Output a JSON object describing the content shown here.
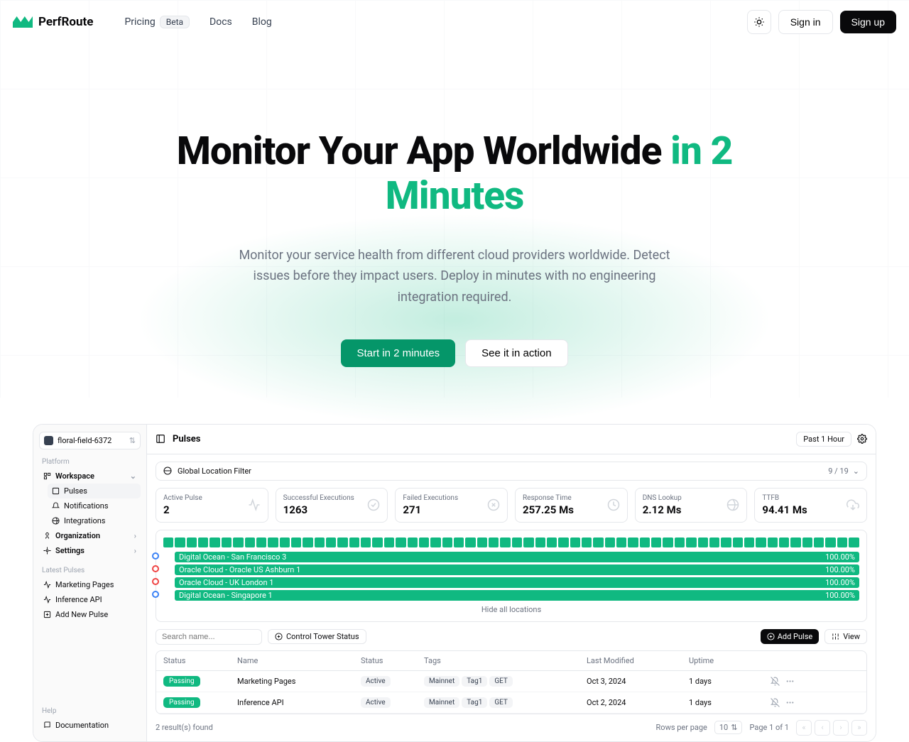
{
  "brand": "PerfRoute",
  "nav": {
    "pricing": "Pricing",
    "pricing_badge": "Beta",
    "docs": "Docs",
    "blog": "Blog"
  },
  "header": {
    "signin": "Sign in",
    "signup": "Sign up"
  },
  "hero": {
    "title_pre": "Monitor Your App Worldwide ",
    "title_accent": "in 2 Minutes",
    "subtitle": "Monitor your service health from different cloud providers worldwide. Detect issues before they impact users. Deploy in minutes with no engineering integration required.",
    "cta_primary": "Start in 2 minutes",
    "cta_secondary": "See it in action"
  },
  "dashboard": {
    "workspace_name": "floral-field-6372",
    "sidebar": {
      "platform_label": "Platform",
      "workspace": "Workspace",
      "pulses": "Pulses",
      "notifications": "Notifications",
      "integrations": "Integrations",
      "organization": "Organization",
      "settings": "Settings",
      "latest_label": "Latest Pulses",
      "lp1": "Marketing Pages",
      "lp2": "Inference API",
      "add_new": "Add New Pulse",
      "help_label": "Help",
      "documentation": "Documentation"
    },
    "topbar": {
      "title": "Pulses",
      "range": "Past 1 Hour"
    },
    "filter": {
      "label": "Global Location Filter",
      "count": "9 / 19"
    },
    "stats": {
      "s1_label": "Active Pulse",
      "s1_value": "2",
      "s2_label": "Successful Executions",
      "s2_value": "1263",
      "s3_label": "Failed Executions",
      "s3_value": "271",
      "s4_label": "Response Time",
      "s4_value": "257.25 Ms",
      "s5_label": "DNS Lookup",
      "s5_value": "2.12 Ms",
      "s6_label": "TTFB",
      "s6_value": "94.41 Ms"
    },
    "locations": {
      "l1_name": "Digital Ocean - San Francisco 3",
      "l1_pct": "100.00%",
      "l2_name": "Oracle Cloud - Oracle US Ashburn 1",
      "l2_pct": "100.00%",
      "l3_name": "Oracle Cloud - UK London 1",
      "l3_pct": "100.00%",
      "l4_name": "Digital Ocean - Singapore 1",
      "l4_pct": "100.00%",
      "hide_all": "Hide all locations"
    },
    "table": {
      "search_placeholder": "Search name...",
      "control_tower": "Control Tower Status",
      "add_pulse": "Add Pulse",
      "view": "View",
      "h_status": "Status",
      "h_name": "Name",
      "h_status2": "Status",
      "h_tags": "Tags",
      "h_modified": "Last Modified",
      "h_uptime": "Uptime",
      "r1_status": "Passing",
      "r1_name": "Marketing Pages",
      "r1_state": "Active",
      "r1_t1": "Mainnet",
      "r1_t2": "Tag1",
      "r1_t3": "GET",
      "r1_modified": "Oct 3, 2024",
      "r1_uptime": "1 days",
      "r2_status": "Passing",
      "r2_name": "Inference API",
      "r2_state": "Active",
      "r2_t1": "Mainnet",
      "r2_t2": "Tag1",
      "r2_t3": "GET",
      "r2_modified": "Oct 2, 2024",
      "r2_uptime": "1 days",
      "results": "2 result(s) found",
      "rows_label": "Rows per page",
      "rows_value": "10",
      "page_label": "Page 1 of 1"
    }
  }
}
